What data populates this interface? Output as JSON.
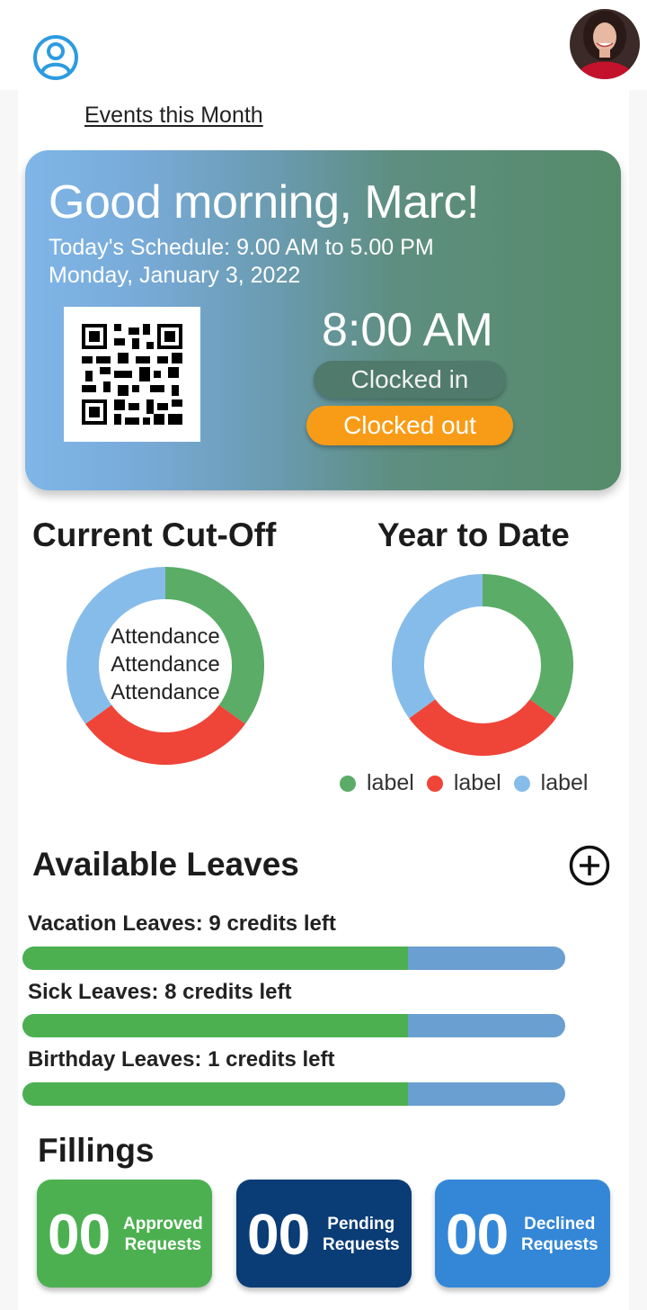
{
  "header": {
    "user_icon": "user-circle-icon",
    "avatar": "profile-photo"
  },
  "events_link": "Events this Month",
  "hero": {
    "greeting": "Good morning, Marc!",
    "schedule": "Today's Schedule: 9.00 AM to 5.00 PM",
    "date": "Monday, January 3, 2022",
    "time": "8:00 AM",
    "clocked_in_label": "Clocked in",
    "clocked_out_label": "Clocked out",
    "qr_icon": "qr-code-icon"
  },
  "current_cutoff": {
    "title": "Current Cut-Off",
    "center_lines": [
      "Attendance",
      "Attendance",
      "Attendance"
    ]
  },
  "year_to_date": {
    "title": "Year to Date"
  },
  "legend": [
    {
      "label": "label",
      "color": "#5aac67"
    },
    {
      "label": "label",
      "color": "#ef4438"
    },
    {
      "label": "label",
      "color": "#86bcea"
    }
  ],
  "chart_data": [
    {
      "type": "pie",
      "title": "Current Cut-Off",
      "categories": [
        "label",
        "label",
        "label"
      ],
      "values": [
        35,
        30,
        35
      ],
      "colors": [
        "#5aac67",
        "#ef4438",
        "#86bcea"
      ]
    },
    {
      "type": "pie",
      "title": "Year to Date",
      "categories": [
        "label",
        "label",
        "label"
      ],
      "values": [
        35,
        30,
        35
      ],
      "colors": [
        "#5aac67",
        "#ef4438",
        "#86bcea"
      ]
    }
  ],
  "leaves": {
    "title": "Available Leaves",
    "add_icon": "plus-circle-icon",
    "items": [
      {
        "label": "Vacation Leaves: 9 credits left",
        "fraction": 0.71
      },
      {
        "label": "Sick Leaves: 8 credits left",
        "fraction": 0.71
      },
      {
        "label": "Birthday Leaves: 1 credits left",
        "fraction": 0.71
      }
    ]
  },
  "fillings": {
    "title": "Fillings",
    "cards": [
      {
        "count": "00",
        "line1": "Approved",
        "line2": "Requests",
        "color": "#4cb050"
      },
      {
        "count": "00",
        "line1": "Pending",
        "line2": "Requests",
        "color": "#0a3c76"
      },
      {
        "count": "00",
        "line1": "Declined",
        "line2": "Requests",
        "color": "#3487d6"
      }
    ]
  }
}
